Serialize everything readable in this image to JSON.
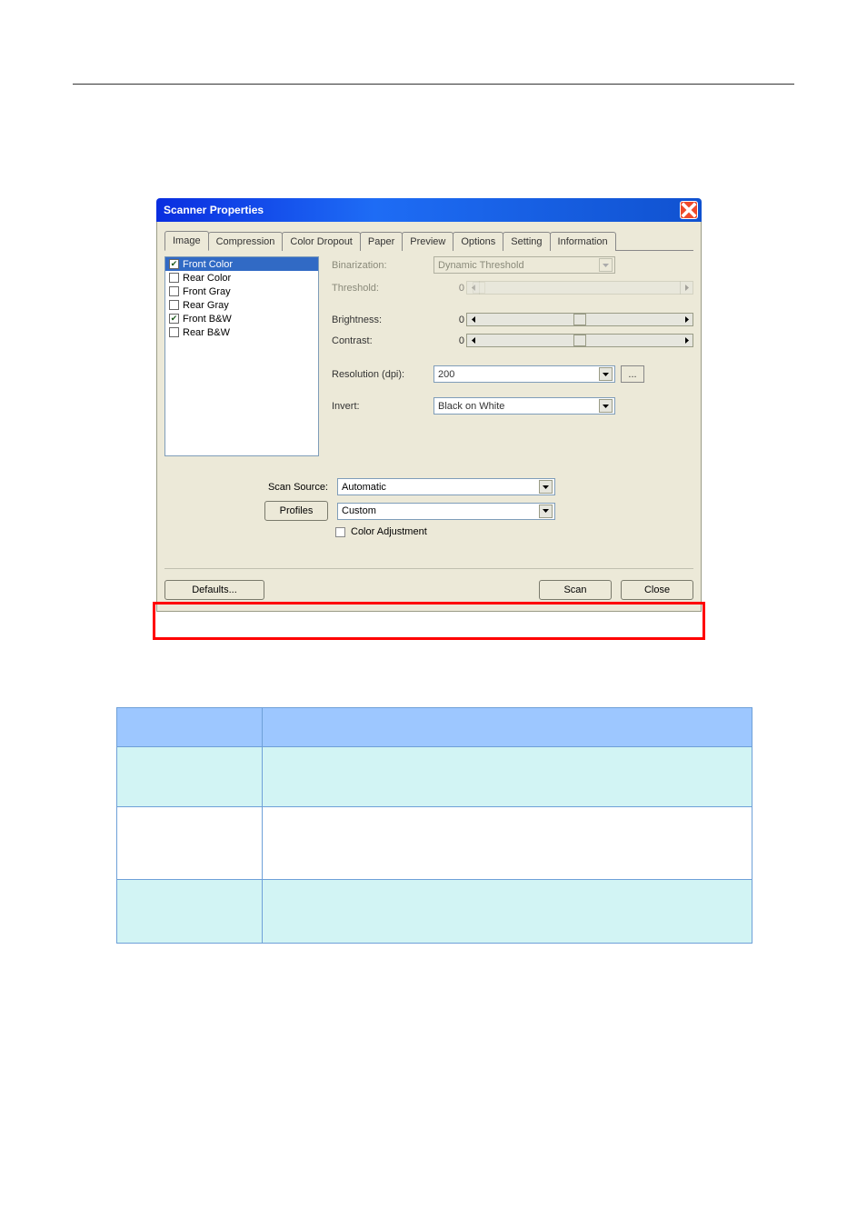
{
  "titlebar": {
    "title": "Scanner Properties"
  },
  "tabs": [
    "Image",
    "Compression",
    "Color Dropout",
    "Paper",
    "Preview",
    "Options",
    "Setting",
    "Information"
  ],
  "active_tab_index": 0,
  "sidebar": {
    "items": [
      {
        "label": "Front Color",
        "checked": true,
        "selected": true
      },
      {
        "label": "Rear Color",
        "checked": false,
        "selected": false
      },
      {
        "label": "Front Gray",
        "checked": false,
        "selected": false
      },
      {
        "label": "Rear Gray",
        "checked": false,
        "selected": false
      },
      {
        "label": "Front B&W",
        "checked": true,
        "selected": false
      },
      {
        "label": "Rear B&W",
        "checked": false,
        "selected": false
      }
    ]
  },
  "form": {
    "binarization": {
      "label": "Binarization:",
      "value": "Dynamic Threshold",
      "enabled": false
    },
    "threshold": {
      "label": "Threshold:",
      "value": "0",
      "enabled": false
    },
    "brightness": {
      "label": "Brightness:",
      "value": "0",
      "enabled": true
    },
    "contrast": {
      "label": "Contrast:",
      "value": "0",
      "enabled": true
    },
    "resolution": {
      "label": "Resolution (dpi):",
      "value": "200",
      "enabled": true
    },
    "invert": {
      "label": "Invert:",
      "value": "Black on White",
      "enabled": true
    }
  },
  "lower": {
    "scan_source": {
      "label": "Scan Source:",
      "value": "Automatic"
    },
    "profiles": {
      "button": "Profiles",
      "value": "Custom"
    },
    "color_adjustment": {
      "label": "Color Adjustment",
      "checked": false
    }
  },
  "buttons": {
    "defaults": "Defaults...",
    "scan": "Scan",
    "close": "Close",
    "ellipsis": "..."
  },
  "table": {
    "header": {
      "c1": "",
      "c2": ""
    },
    "rows": [
      {
        "c1": "",
        "c2": ""
      },
      {
        "c1": "",
        "c2": ""
      },
      {
        "c1": "",
        "c2": ""
      }
    ]
  }
}
